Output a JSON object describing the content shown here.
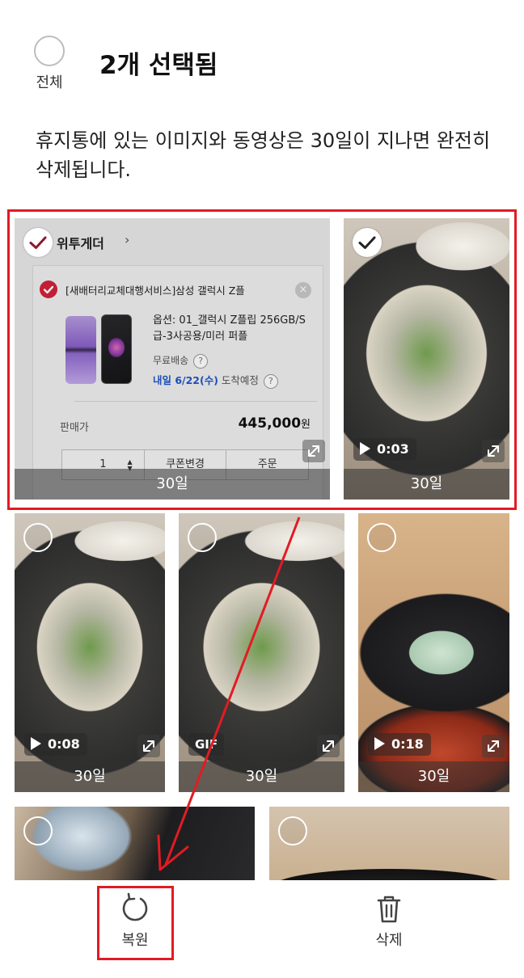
{
  "header": {
    "select_all_label": "전체",
    "title": "2개 선택됨"
  },
  "notice": "휴지통에 있는 이미지와 동영상은 30일이 지나면 완전히 삭제됩니다.",
  "items": [
    {
      "type": "screenshot",
      "selected": true,
      "days_left": "30일"
    },
    {
      "type": "video",
      "selected": true,
      "duration": "0:03",
      "days_left": "30일"
    },
    {
      "type": "video",
      "selected": false,
      "duration": "0:08",
      "days_left": "30일"
    },
    {
      "type": "gif",
      "selected": false,
      "badge": "GIF",
      "days_left": "30일"
    },
    {
      "type": "video",
      "selected": false,
      "duration": "0:18",
      "days_left": "30일"
    },
    {
      "type": "image",
      "selected": false
    },
    {
      "type": "image",
      "selected": false
    }
  ],
  "shopping_screenshot": {
    "seller": "위투게더",
    "seller_arrow": "›",
    "product_name": "[새배터리교체대행서비스]삼성 갤럭시 Z플",
    "option": "옵션: 01_갤럭시 Z플립 256GB/S급-3사공용/미러 퍼플",
    "shipping": "무료배송",
    "arrival_date": "내일 6/22(수)",
    "arrival_suffix": "도착예정",
    "price_label": "판매가",
    "price": "445,000",
    "price_unit": "원",
    "quantity": "1",
    "coupon_button": "쿠폰변경",
    "order_button": "주문",
    "help_mark": "?",
    "remove_mark": "×"
  },
  "bottom_actions": {
    "restore_label": "복원",
    "delete_label": "삭제"
  },
  "colors": {
    "highlight": "#e21b23",
    "accent_red": "#d3213a",
    "link_blue": "#1f56c8"
  },
  "icons": {
    "restore": "restore-icon",
    "delete": "trash-icon",
    "expand": "expand-icon",
    "play": "play-icon"
  }
}
